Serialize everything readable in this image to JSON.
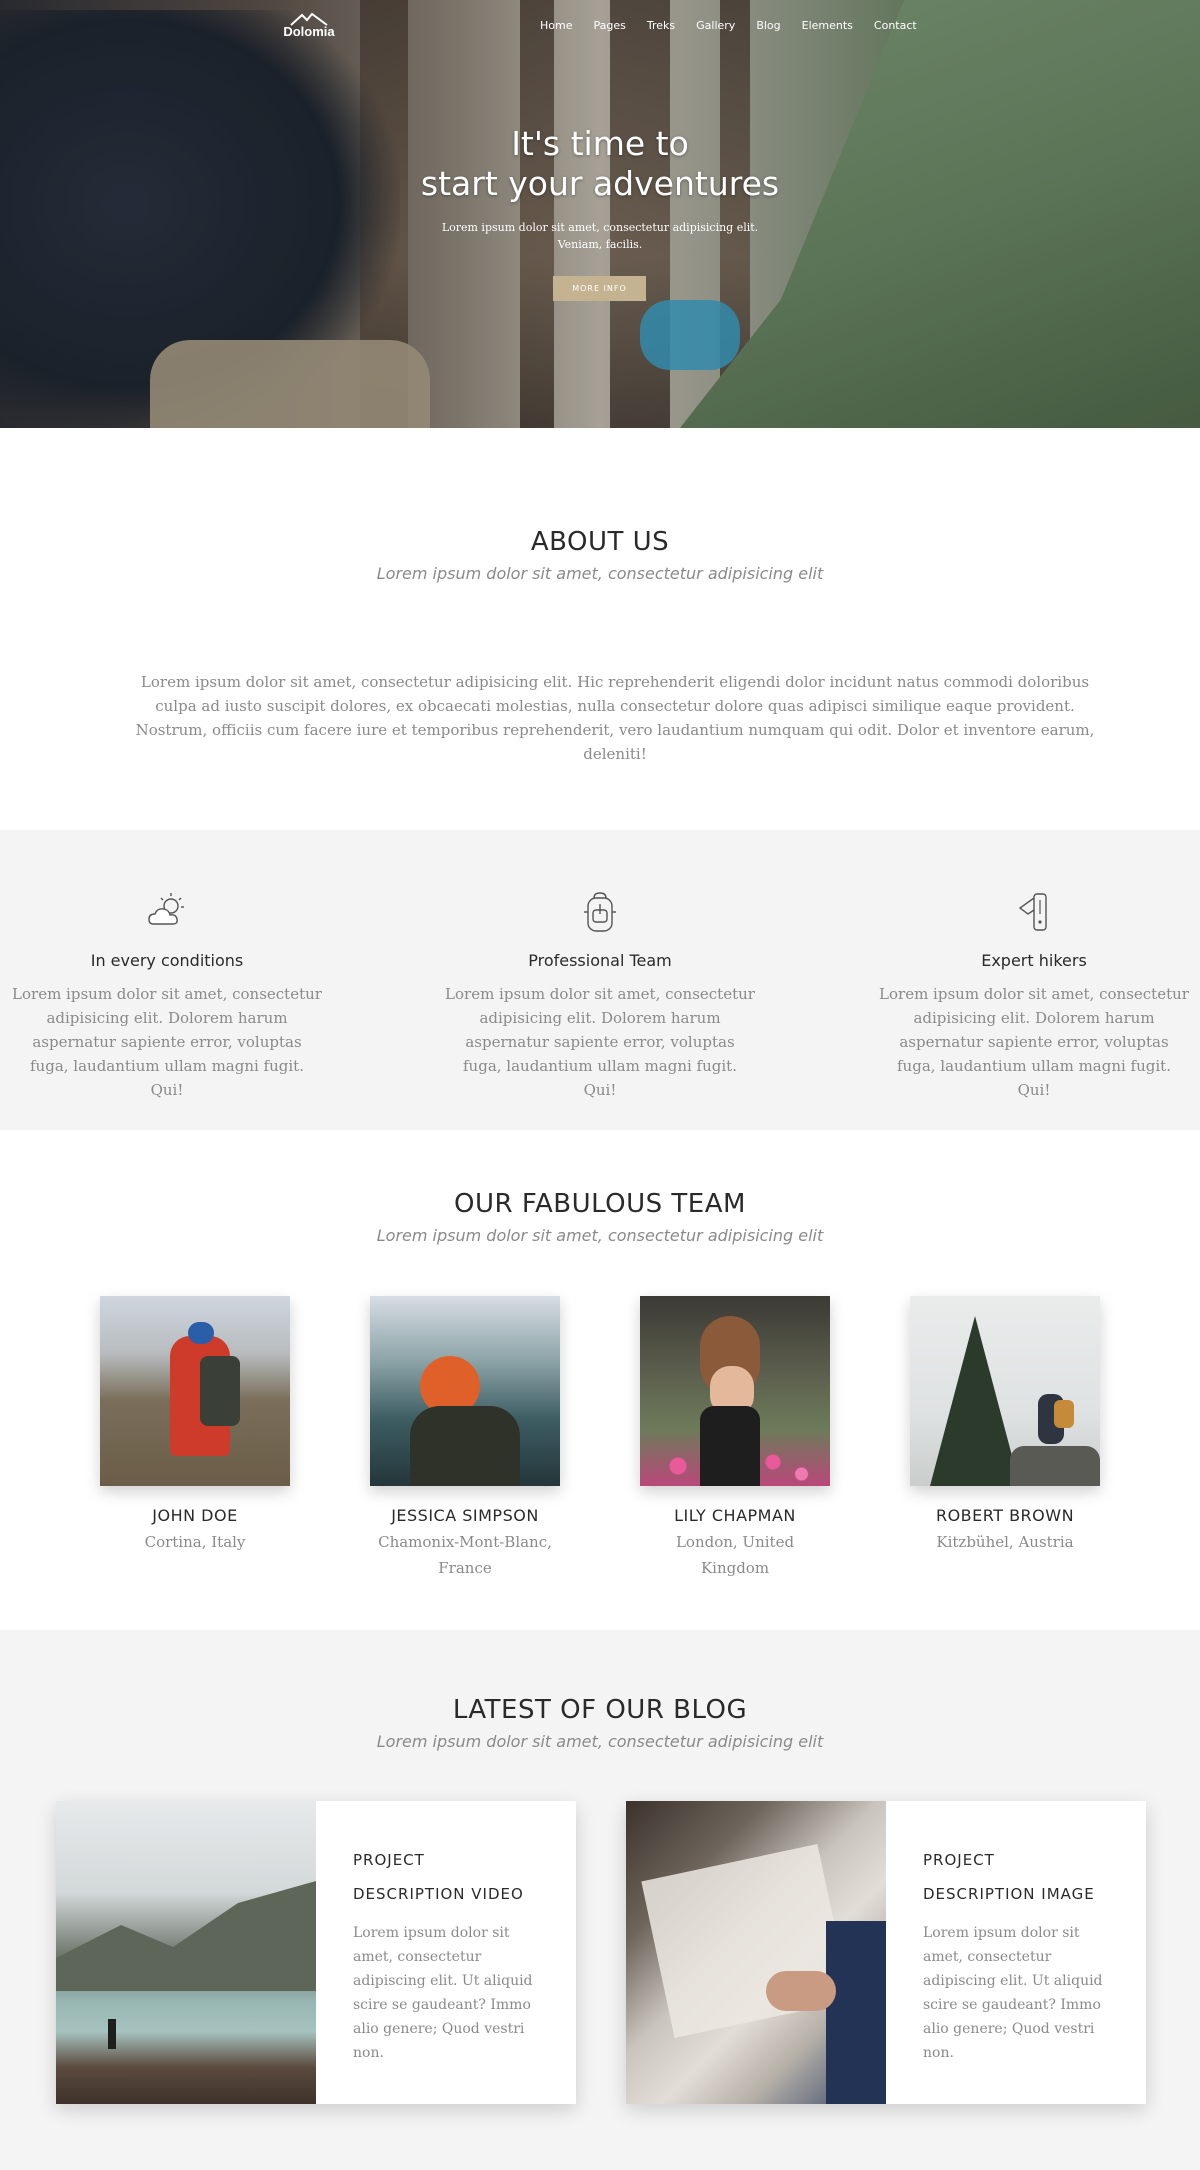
{
  "brand": {
    "logo_text": "Dolomia"
  },
  "nav": {
    "items": [
      {
        "label": "Home"
      },
      {
        "label": "Pages"
      },
      {
        "label": "Treks"
      },
      {
        "label": "Gallery"
      },
      {
        "label": "Blog"
      },
      {
        "label": "Elements"
      },
      {
        "label": "Contact"
      }
    ]
  },
  "hero": {
    "title_line1": "It's time to",
    "title_line2": "start your adventures",
    "subtitle_line1": "Lorem ipsum dolor sit amet, consectetur adipisicing elit.",
    "subtitle_line2": "Veniam, facilis.",
    "button_label": "MORE INFO"
  },
  "about": {
    "title": "ABOUT US",
    "subtitle": "Lorem ipsum dolor sit amet, consectetur adipisicing elit",
    "body": "Lorem ipsum dolor sit amet, consectetur adipisicing elit. Hic reprehenderit eligendi dolor incidunt natus commodi doloribus culpa ad iusto suscipit dolores, ex obcaecati molestias, nulla consectetur dolore quas adipisci similique eaque provident. Nostrum, officiis cum facere iure et temporibus reprehenderit, vero laudantium numquam qui odit. Dolor et inventore earum, deleniti!"
  },
  "features": [
    {
      "icon": "cloud-sun-icon",
      "title": "In every conditions",
      "text": "Lorem ipsum dolor sit amet, consectetur adipisicing elit. Dolorem harum aspernatur sapiente error, voluptas fuga, laudantium ullam magni fugit. Qui!"
    },
    {
      "icon": "backpack-icon",
      "title": "Professional Team",
      "text": "Lorem ipsum dolor sit amet, consectetur adipisicing elit. Dolorem harum aspernatur sapiente error, voluptas fuga, laudantium ullam magni fugit. Qui!"
    },
    {
      "icon": "pocket-knife-icon",
      "title": "Expert hikers",
      "text": "Lorem ipsum dolor sit amet, consectetur adipisicing elit. Dolorem harum aspernatur sapiente error, voluptas fuga, laudantium ullam magni fugit. Qui!"
    }
  ],
  "team": {
    "title": "OUR FABULOUS TEAM",
    "subtitle": "Lorem ipsum dolor sit amet, consectetur adipisicing elit",
    "members": [
      {
        "name": "JOHN DOE",
        "location": "Cortina, Italy"
      },
      {
        "name": "JESSICA SIMPSON",
        "location": "Chamonix-Mont-Blanc, France"
      },
      {
        "name": "LILY CHAPMAN",
        "location": "London, United Kingdom"
      },
      {
        "name": "ROBERT BROWN",
        "location": "Kitzbühel, Austria"
      }
    ]
  },
  "blog": {
    "title": "LATEST OF OUR BLOG",
    "subtitle": "Lorem ipsum dolor sit amet, consectetur adipisicing elit",
    "posts": [
      {
        "title_line1": "PROJECT",
        "title_line2": "DESCRIPTION VIDEO",
        "text": "Lorem ipsum dolor sit amet, consectetur adipiscing elit. Ut aliquid scire se gaudeant? Immo alio genere; Quod vestri non."
      },
      {
        "title_line1": "PROJECT",
        "title_line2": "DESCRIPTION IMAGE",
        "text": "Lorem ipsum dolor sit amet, consectetur adipiscing elit. Ut aliquid scire se gaudeant? Immo alio genere; Quod vestri non."
      }
    ]
  },
  "colors": {
    "accent_button": "#c5b290",
    "section_gray": "#f4f4f4",
    "heading": "#2a2a2a",
    "muted_text": "#8a8a8a"
  }
}
